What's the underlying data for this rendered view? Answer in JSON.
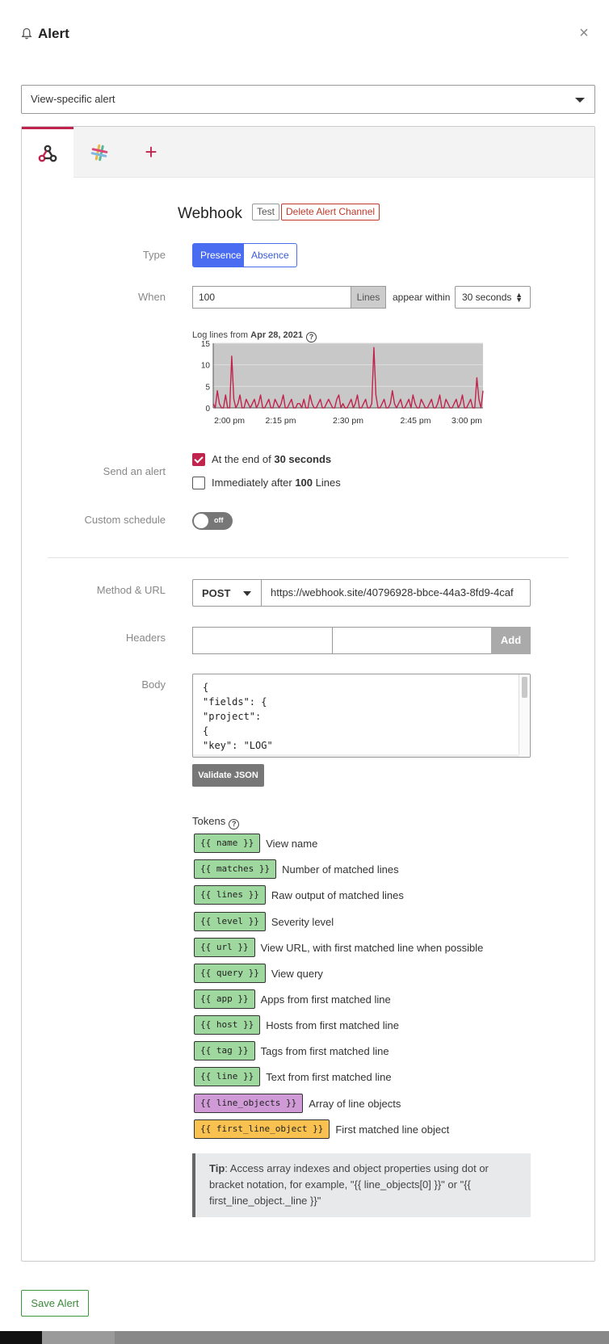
{
  "header": {
    "title": "Alert",
    "close_label": "×"
  },
  "scope_select": {
    "value": "View-specific alert"
  },
  "tabs": [
    {
      "icon": "webhook-icon",
      "active": true
    },
    {
      "icon": "slack-icon",
      "active": false
    },
    {
      "icon": "plus-icon",
      "label": "+",
      "active": false
    }
  ],
  "channel": {
    "title": "Webhook",
    "test_label": "Test",
    "delete_label": "Delete Alert Channel"
  },
  "type": {
    "label": "Type",
    "options": [
      "Presence",
      "Absence"
    ],
    "selected": "Presence"
  },
  "when": {
    "label": "When",
    "count": "100",
    "unit": "Lines",
    "connector": "appear within",
    "window": "30 seconds"
  },
  "chart_caption": {
    "prefix": "Log lines from ",
    "date": "Apr 28, 2021"
  },
  "chart_data": {
    "type": "area",
    "title": "",
    "xlabel": "",
    "ylabel": "",
    "ylim": [
      0,
      15
    ],
    "yticks": [
      "0",
      "5",
      "10",
      "15"
    ],
    "xticks": [
      "2:00 pm",
      "2:15 pm",
      "2:30 pm",
      "2:45 pm",
      "3:00 pm"
    ],
    "grid": true,
    "color": "#c0234c",
    "values": [
      1,
      0,
      4,
      1,
      0,
      0,
      3,
      0,
      0,
      12,
      2,
      0,
      1,
      3,
      0,
      0,
      2,
      1,
      0,
      1,
      2,
      0,
      1,
      3,
      0,
      0,
      1,
      2,
      0,
      0,
      2,
      1,
      0,
      1,
      3,
      0,
      0,
      1,
      2,
      0,
      0,
      1,
      1,
      0,
      2,
      0,
      0,
      3,
      1,
      0,
      0,
      1,
      2,
      0,
      0,
      1,
      2,
      1,
      0,
      0,
      2,
      3,
      0,
      1,
      0,
      0,
      1,
      2,
      0,
      1,
      3,
      0,
      0,
      1,
      2,
      0,
      0,
      1,
      14,
      3,
      0,
      0,
      1,
      2,
      0,
      0,
      1,
      4,
      1,
      0,
      1,
      2,
      0,
      0,
      1,
      2,
      0,
      3,
      1,
      0,
      0,
      2,
      1,
      0,
      0,
      1,
      2,
      0,
      0,
      1,
      3,
      0,
      0,
      2,
      1,
      0,
      0,
      1,
      2,
      0,
      1,
      3,
      0,
      0,
      1,
      2,
      0,
      0,
      7,
      2,
      0,
      4
    ]
  },
  "send_alert": {
    "label": "Send an alert",
    "option1_prefix": "At the end of ",
    "option1_value": "30 seconds",
    "option2_prefix": "Immediately after ",
    "option2_value": "100",
    "option2_suffix": " Lines"
  },
  "schedule": {
    "label": "Custom schedule",
    "toggle_text": "off"
  },
  "method_url": {
    "label": "Method & URL",
    "method": "POST",
    "url": "https://webhook.site/40796928-bbce-44a3-8fd9-4caf"
  },
  "headers": {
    "label": "Headers",
    "add_label": "Add"
  },
  "body": {
    "label": "Body",
    "content": "{\n\"fields\": {\n\"project\":\n{\n\"key\": \"LOG\"\n},"
  },
  "validate_label": "Validate JSON",
  "tokens": {
    "title": "Tokens",
    "items": [
      {
        "token": "{{ name }}",
        "desc": "View name",
        "color": "green"
      },
      {
        "token": "{{ matches }}",
        "desc": "Number of matched lines",
        "color": "green"
      },
      {
        "token": "{{ lines }}",
        "desc": "Raw output of matched lines",
        "color": "green"
      },
      {
        "token": "{{ level }}",
        "desc": "Severity level",
        "color": "green"
      },
      {
        "token": "{{ url }}",
        "desc": "View URL, with first matched line when possible",
        "color": "green"
      },
      {
        "token": "{{ query }}",
        "desc": "View query",
        "color": "green"
      },
      {
        "token": "{{ app }}",
        "desc": "Apps from first matched line",
        "color": "green"
      },
      {
        "token": "{{ host }}",
        "desc": "Hosts from first matched line",
        "color": "green"
      },
      {
        "token": "{{ tag }}",
        "desc": "Tags from first matched line",
        "color": "green"
      },
      {
        "token": "{{ line }}",
        "desc": "Text from first matched line",
        "color": "green"
      },
      {
        "token": "{{ line_objects }}",
        "desc": "Array of line objects",
        "color": "purple"
      },
      {
        "token": "{{ first_line_object }}",
        "desc": "First matched line object",
        "color": "yellow"
      }
    ]
  },
  "tip": {
    "bold": "Tip",
    "text": ": Access array indexes and object properties using dot or bracket notation, for example, \"{{ line_objects[0] }}\" or \"{{ first_line_object._line }}\""
  },
  "save_label": "Save Alert",
  "colors": {
    "accent": "#c0234c",
    "primary": "#4a6cf0",
    "success": "#3a8a3a"
  }
}
